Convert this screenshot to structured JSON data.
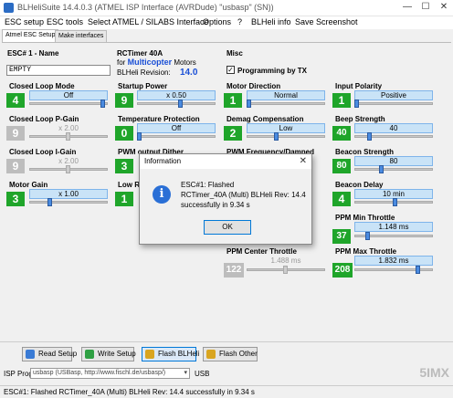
{
  "window": {
    "title": "BLHeliSuite 14.4.0.3  (ATMEL ISP Interface (AVRDude) \"usbasp\" (SN))",
    "minimize": "—",
    "maximize": "☐",
    "close": "✕"
  },
  "menu": [
    "ESC setup",
    "ESC tools",
    "Select ATMEL / SILABS Interface",
    "Options",
    "?",
    "BLHeli info",
    "Save Screenshot"
  ],
  "tabs": [
    "Atmel ESC Setup",
    "Make interfaces"
  ],
  "esc": {
    "label": "ESC# 1 - Name",
    "name_value": "EMPTY"
  },
  "firmware": {
    "model": "RCTimer 40A",
    "for_label": "for",
    "type": "Multicopter",
    "motors_label": "Motors",
    "revision_label": "BLHeli Revision:",
    "revision": "14.0"
  },
  "misc": {
    "label": "Misc",
    "prog_tx_label": "Programming by TX",
    "prog_tx_mark": "✓"
  },
  "params": {
    "closed_loop_mode": {
      "label": "Closed Loop Mode",
      "value": "Off",
      "num": "4"
    },
    "closed_loop_p": {
      "label": "Closed Loop P-Gain",
      "value": "x 2.00",
      "num": "9"
    },
    "closed_loop_i": {
      "label": "Closed Loop I-Gain",
      "value": "x 2.00",
      "num": "9"
    },
    "motor_gain": {
      "label": "Motor Gain",
      "value": "x 1.00",
      "num": "3"
    },
    "startup_power": {
      "label": "Startup Power",
      "value": "x 0.50",
      "num": "9"
    },
    "temp_protection": {
      "label": "Temperature Protection",
      "value": "Off",
      "num": "0"
    },
    "pwm_dither": {
      "label": "PWM output Dither",
      "num": "3"
    },
    "low_rpm": {
      "label": "Low R",
      "num": "1"
    },
    "motor_direction": {
      "label": "Motor Direction",
      "value": "Normal",
      "num": "1"
    },
    "demag": {
      "label": "Demag Compensation",
      "value": "Low",
      "num": "2"
    },
    "pwm_freq": {
      "label": "PWM Frequency/Damped"
    },
    "ppm_center": {
      "label": "PPM Center Throttle",
      "value": "1.488 ms",
      "num": "122"
    },
    "input_polarity": {
      "label": "Input Polarity",
      "value": "Positive",
      "num": "1"
    },
    "beep_strength": {
      "label": "Beep Strength",
      "value": "40",
      "num": "40"
    },
    "beacon_strength": {
      "label": "Beacon Strength",
      "value": "80",
      "num": "80"
    },
    "beacon_delay": {
      "label": "Beacon Delay",
      "value": "10 min",
      "num": "4"
    },
    "ppm_min": {
      "label": "PPM Min Throttle",
      "value": "1.148 ms",
      "num": "37"
    },
    "ppm_max": {
      "label": "PPM Max Throttle",
      "value": "1.832 ms",
      "num": "208"
    }
  },
  "dialog": {
    "title": "Information",
    "close": "✕",
    "icon_glyph": "i",
    "line1": "ESC#1: Flashed",
    "line2": "RCTimer_40A (Multi) BLHeli Rev: 14.4",
    "line3": "successfully in 9.34 s",
    "ok": "OK"
  },
  "buttons": {
    "read": "Read Setup",
    "write": "Write Setup",
    "flash_blheli": "Flash BLHeli",
    "flash_other": "Flash Other"
  },
  "isp": {
    "label": "ISP Prog:",
    "value": "usbasp (USBasp, http://www.fischl.de/usbasp/)",
    "port": "USB",
    "arrow": "▾"
  },
  "status": "ESC#1: Flashed  RCTimer_40A (Multi) BLHeli Rev: 14.4  successfully in 9.34 s",
  "watermark": "5IMX",
  "colors": {
    "green": "#1fa52a",
    "blue_accent": "#c9e3f7",
    "brand_blue": "#1a4fd6"
  }
}
